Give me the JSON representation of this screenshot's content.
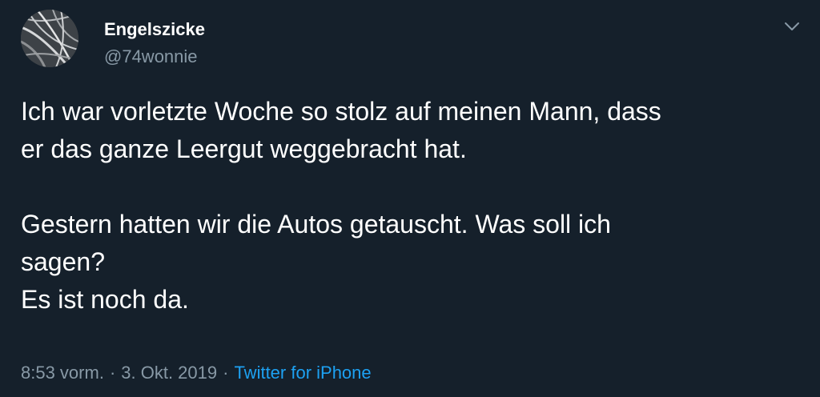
{
  "author": {
    "display_name": "Engelszicke",
    "handle": "@74wonnie",
    "avatar_icon": "user-avatar"
  },
  "menu": {
    "icon": "chevron-down-icon"
  },
  "tweet": {
    "lines": [
      "Ich war vorletzte Woche so stolz auf meinen Mann, dass",
      "er das ganze Leergut weggebracht hat.",
      "Gestern hatten wir die Autos getauscht. Was soll ich",
      "sagen?",
      "Es ist noch da."
    ],
    "time": "8:53 vorm.",
    "date": "3. Okt. 2019",
    "separator": "·",
    "source": "Twitter for iPhone"
  },
  "colors": {
    "background": "#15202b",
    "text": "#ffffff",
    "secondary_text": "#8899a6",
    "link": "#1da1f2"
  }
}
